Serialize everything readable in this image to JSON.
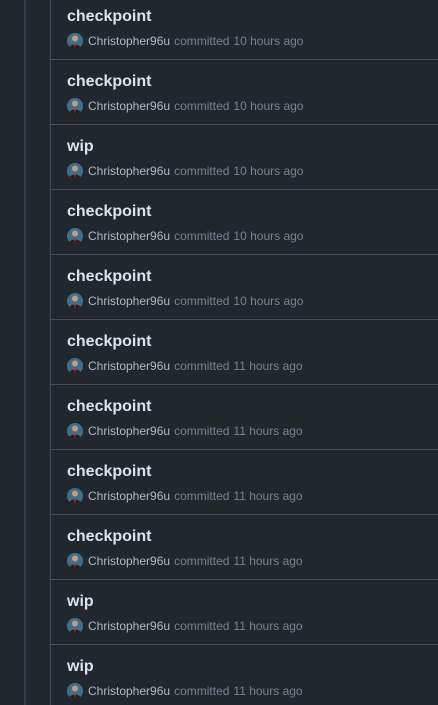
{
  "commits": [
    {
      "title": "checkpoint",
      "author": "Christopher96u",
      "verb": "committed",
      "time": "10 hours ago"
    },
    {
      "title": "checkpoint",
      "author": "Christopher96u",
      "verb": "committed",
      "time": "10 hours ago"
    },
    {
      "title": "wip",
      "author": "Christopher96u",
      "verb": "committed",
      "time": "10 hours ago"
    },
    {
      "title": "checkpoint",
      "author": "Christopher96u",
      "verb": "committed",
      "time": "10 hours ago"
    },
    {
      "title": "checkpoint",
      "author": "Christopher96u",
      "verb": "committed",
      "time": "10 hours ago"
    },
    {
      "title": "checkpoint",
      "author": "Christopher96u",
      "verb": "committed",
      "time": "11 hours ago"
    },
    {
      "title": "checkpoint",
      "author": "Christopher96u",
      "verb": "committed",
      "time": "11 hours ago"
    },
    {
      "title": "checkpoint",
      "author": "Christopher96u",
      "verb": "committed",
      "time": "11 hours ago"
    },
    {
      "title": "checkpoint",
      "author": "Christopher96u",
      "verb": "committed",
      "time": "11 hours ago"
    },
    {
      "title": "wip",
      "author": "Christopher96u",
      "verb": "committed",
      "time": "11 hours ago"
    },
    {
      "title": "wip",
      "author": "Christopher96u",
      "verb": "committed",
      "time": "11 hours ago"
    }
  ],
  "avatar_icon": "user-avatar-icon",
  "colors": {
    "background": "#22272e",
    "title": "#dde3ea",
    "meta": "#768390",
    "divider": "#444c56"
  }
}
